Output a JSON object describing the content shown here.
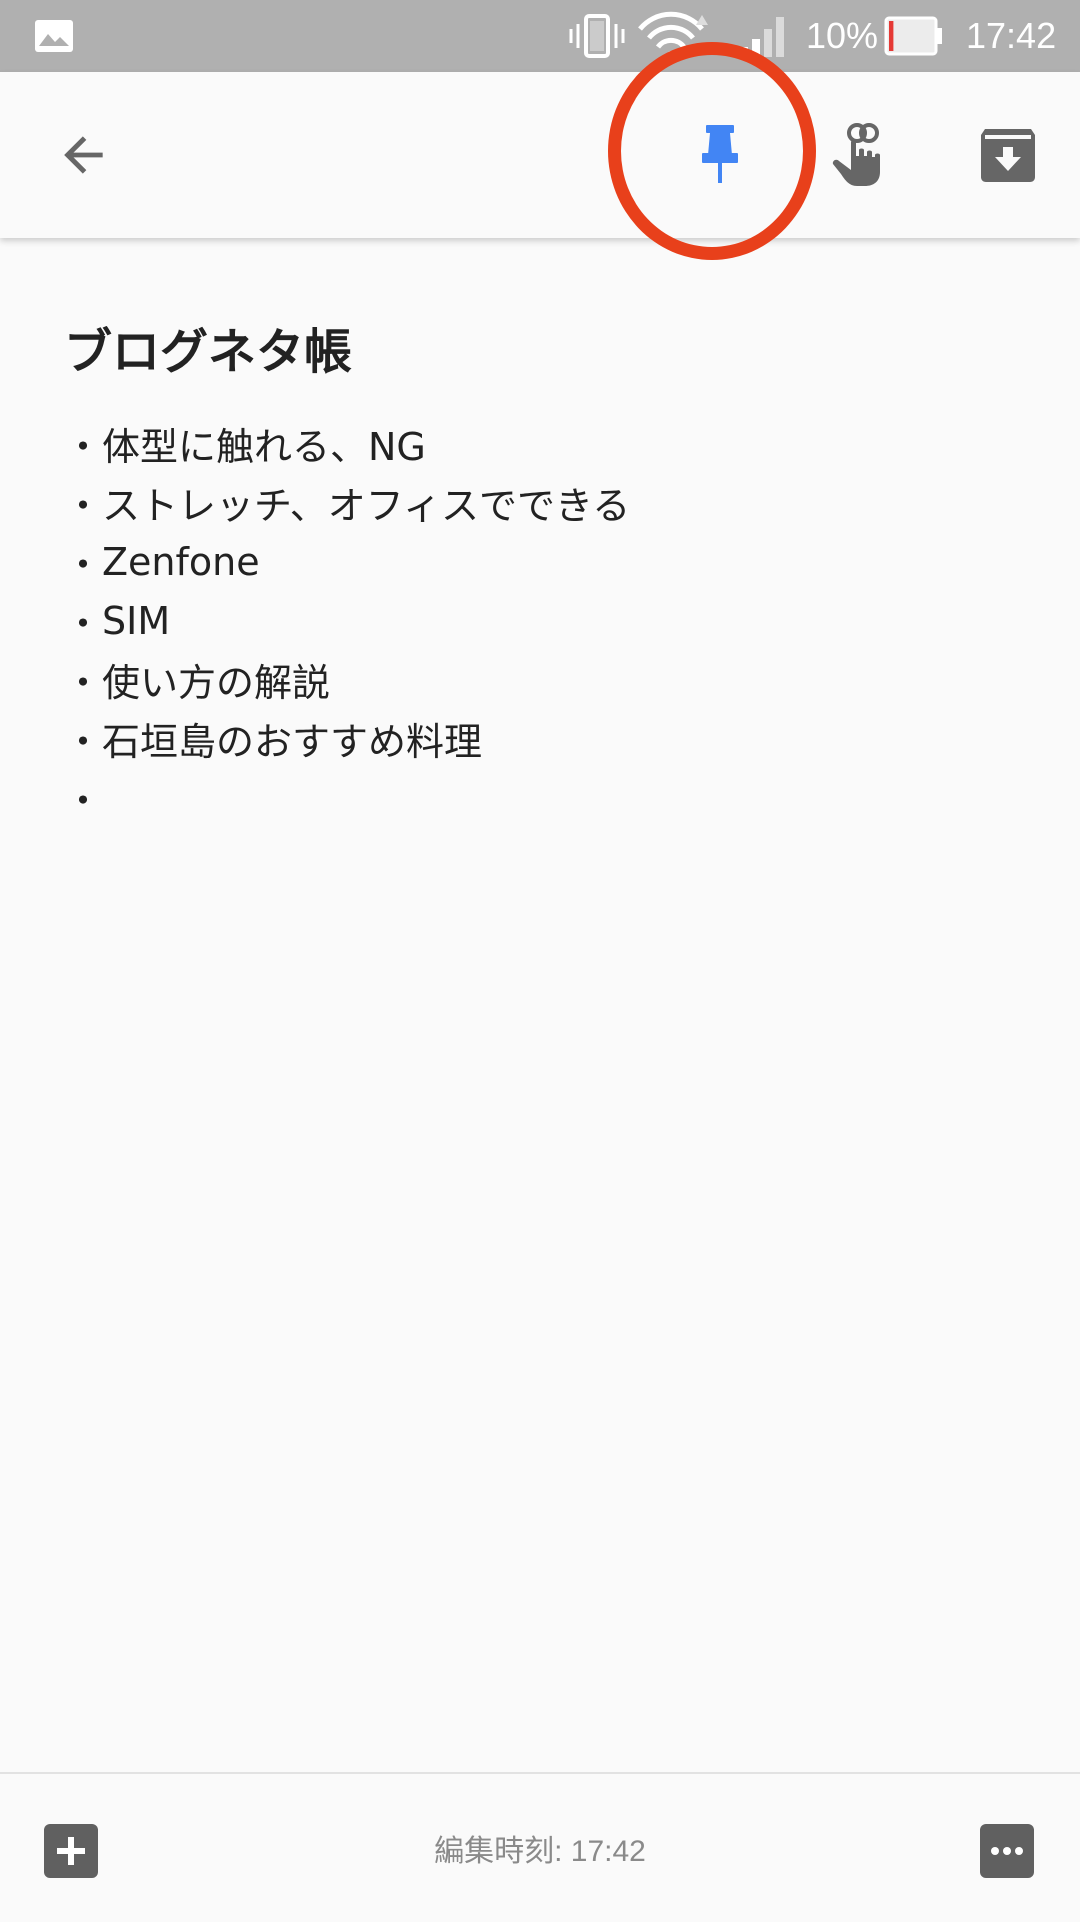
{
  "status_bar": {
    "battery_percent": "10%",
    "time": "17:42",
    "battery_level": 0.1,
    "colors": {
      "background": "#b0b0b0",
      "battery_low": "#e53935"
    }
  },
  "toolbar": {
    "icons": [
      "back-arrow-icon",
      "pin-icon",
      "reminder-icon",
      "archive-icon"
    ],
    "colors": {
      "pin_active": "#4285f4",
      "icon": "#666666",
      "highlight": "#e8401b"
    }
  },
  "note": {
    "title": "ブログネタ帳",
    "bullet": "・",
    "items": [
      "体型に触れる、NG",
      "ストレッチ、オフィスでできる",
      "Zenfone",
      "SIM",
      "使い方の解説",
      "石垣島のおすすめ料理",
      ""
    ]
  },
  "bottom_bar": {
    "edited_label": "編集時刻: 17:42",
    "icons": [
      "add-box-icon",
      "more-options-icon"
    ]
  }
}
